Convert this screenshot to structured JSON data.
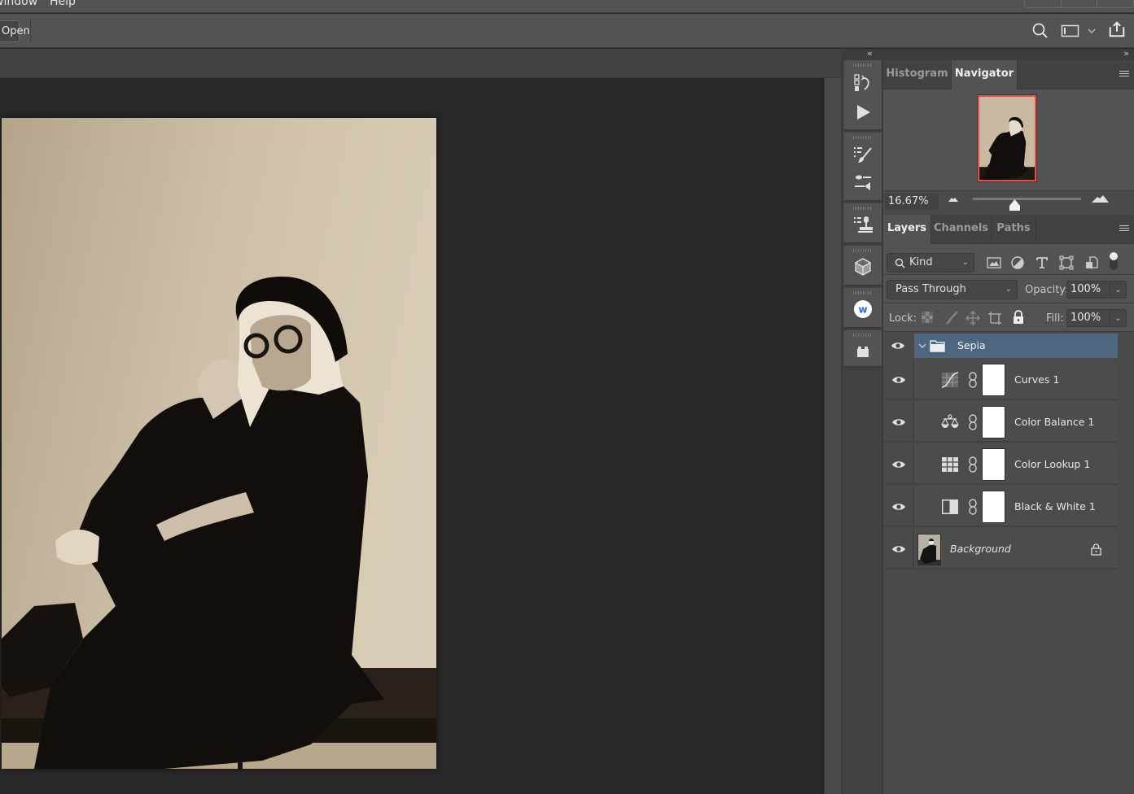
{
  "menubar": {
    "items": [
      "Window",
      "Help"
    ]
  },
  "options_bar": {
    "open_button": "Open",
    "icons": [
      "search-icon",
      "workspace-icon",
      "chevron-down-icon",
      "share-icon"
    ]
  },
  "dock": {
    "collapse_glyph": "«",
    "groups": [
      [
        "history-icon",
        "play-actions-icon"
      ],
      [
        "brush-presets-icon",
        "brush-settings-icon"
      ],
      [
        "clone-source-icon"
      ],
      [
        "3d-cube-icon"
      ],
      [
        "w-plugin-icon"
      ],
      [
        "plugins-icon"
      ]
    ]
  },
  "panels": {
    "expand_glyph": "»",
    "top_tabs": [
      {
        "label": "Histogram",
        "active": false
      },
      {
        "label": "Navigator",
        "active": true
      }
    ],
    "navigator": {
      "zoom": "16.67%",
      "zoom_slider_fraction": 0.39
    },
    "layer_tabs": [
      {
        "label": "Layers",
        "active": true
      },
      {
        "label": "Channels",
        "active": false
      },
      {
        "label": "Paths",
        "active": false
      }
    ],
    "filter": {
      "kind_label": "Kind",
      "icons": [
        "image-filter-icon",
        "adjustment-filter-icon",
        "type-filter-icon",
        "shape-filter-icon",
        "smart-object-filter-icon"
      ]
    },
    "blend_mode": "Pass Through",
    "opacity_label": "Opacity:",
    "opacity": "100%",
    "lock_label": "Lock:",
    "fill_label": "Fill:",
    "fill": "100%",
    "layers": [
      {
        "name": "Sepia",
        "type": "group",
        "visible": true,
        "selected": true,
        "expanded": true
      },
      {
        "name": "Curves 1",
        "type": "curves",
        "visible": true
      },
      {
        "name": "Color Balance 1",
        "type": "color-balance",
        "visible": true
      },
      {
        "name": "Color Lookup 1",
        "type": "color-lookup",
        "visible": true
      },
      {
        "name": "Black & White 1",
        "type": "black-white",
        "visible": true
      },
      {
        "name": "Background",
        "type": "pixel",
        "visible": true,
        "locked": true
      }
    ]
  },
  "colors": {
    "selection": "#4f6680",
    "nav_frame": "#ee4b4b",
    "panel_bg": "#535353",
    "canvas_bg": "#282828"
  }
}
